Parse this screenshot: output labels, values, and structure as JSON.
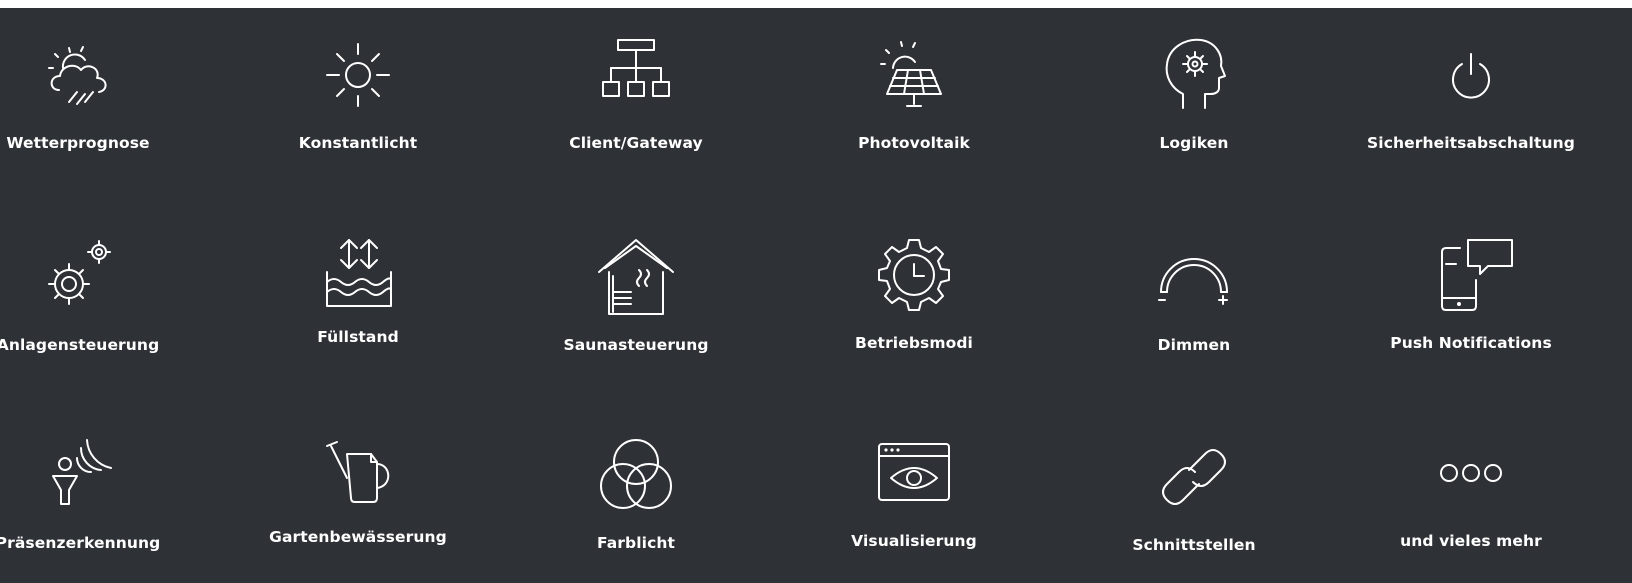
{
  "features": [
    {
      "label": "Wetterprognose",
      "icon": "weather-icon"
    },
    {
      "label": "Konstantlicht",
      "icon": "sun-icon"
    },
    {
      "label": "Client/Gateway",
      "icon": "network-hierarchy-icon"
    },
    {
      "label": "Photovoltaik",
      "icon": "solar-panel-icon"
    },
    {
      "label": "Logiken",
      "icon": "head-gear-icon"
    },
    {
      "label": "Sicherheitsabschaltung",
      "icon": "power-icon"
    },
    {
      "label": "Anlagensteuerung",
      "icon": "gears-icon"
    },
    {
      "label": "Füllstand",
      "icon": "water-level-icon"
    },
    {
      "label": "Saunasteuerung",
      "icon": "sauna-house-icon"
    },
    {
      "label": "Betriebsmodi",
      "icon": "gear-clock-icon"
    },
    {
      "label": "Dimmen",
      "icon": "dimmer-arc-icon"
    },
    {
      "label": "Push Notifications",
      "icon": "phone-message-icon"
    },
    {
      "label": "Präsenzerkennung",
      "icon": "presence-sensor-icon"
    },
    {
      "label": "Gartenbewässerung",
      "icon": "watering-can-icon"
    },
    {
      "label": "Farblicht",
      "icon": "color-circles-icon"
    },
    {
      "label": "Visualisierung",
      "icon": "browser-eye-icon"
    },
    {
      "label": "Schnittstellen",
      "icon": "chain-link-icon"
    },
    {
      "label": "und vieles mehr",
      "icon": "more-dots-icon"
    }
  ]
}
